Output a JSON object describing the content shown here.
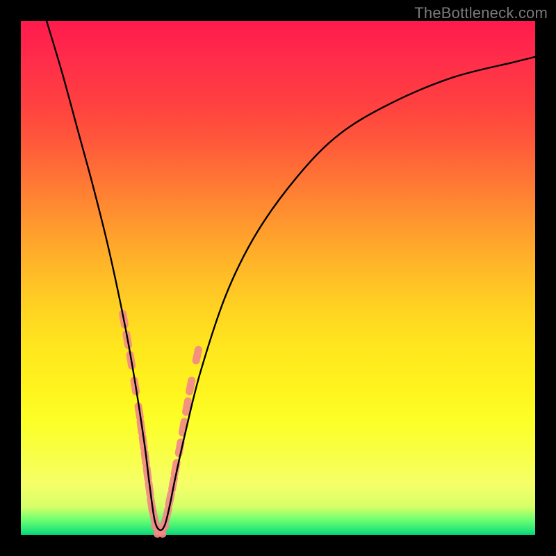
{
  "watermark": "TheBottleneck.com",
  "chart_data": {
    "type": "line",
    "title": "",
    "xlabel": "",
    "ylabel": "",
    "xlim": [
      0,
      100
    ],
    "ylim": [
      0,
      100
    ],
    "curve": {
      "name": "bottleneck-curve",
      "description": "V-shaped bottleneck curve. Steep left branch descends from top-left to a minimum near x≈26, then right branch rises with decreasing slope toward top-right.",
      "x": [
        5,
        8,
        11,
        14,
        17,
        20,
        22,
        24,
        25,
        26,
        27,
        28,
        29,
        30,
        32,
        35,
        40,
        46,
        54,
        62,
        72,
        84,
        96,
        100
      ],
      "y": [
        100,
        90,
        79,
        68,
        56,
        42,
        31,
        18,
        10,
        3,
        1,
        2,
        6,
        11,
        20,
        32,
        47,
        59,
        70,
        78,
        84,
        89,
        92,
        93
      ]
    },
    "markers": {
      "name": "highlighted-points",
      "type": "scatter",
      "color": "#f28a88",
      "description": "Pink dashed/capsule markers clustered along the lower portion of both branches near the valley.",
      "points": [
        {
          "x": 20.0,
          "y": 42
        },
        {
          "x": 20.7,
          "y": 38
        },
        {
          "x": 21.4,
          "y": 34
        },
        {
          "x": 22.2,
          "y": 29
        },
        {
          "x": 23.0,
          "y": 24
        },
        {
          "x": 23.4,
          "y": 21
        },
        {
          "x": 23.8,
          "y": 18
        },
        {
          "x": 24.2,
          "y": 15
        },
        {
          "x": 24.6,
          "y": 12
        },
        {
          "x": 25.0,
          "y": 9
        },
        {
          "x": 25.4,
          "y": 6
        },
        {
          "x": 25.8,
          "y": 4
        },
        {
          "x": 26.3,
          "y": 2
        },
        {
          "x": 26.8,
          "y": 1
        },
        {
          "x": 27.3,
          "y": 1
        },
        {
          "x": 27.8,
          "y": 2
        },
        {
          "x": 28.4,
          "y": 4
        },
        {
          "x": 29.0,
          "y": 7
        },
        {
          "x": 29.6,
          "y": 10
        },
        {
          "x": 30.1,
          "y": 13
        },
        {
          "x": 30.9,
          "y": 17
        },
        {
          "x": 31.6,
          "y": 21
        },
        {
          "x": 32.3,
          "y": 25
        },
        {
          "x": 33.0,
          "y": 29
        },
        {
          "x": 34.3,
          "y": 35
        }
      ]
    },
    "gradient_stops": [
      {
        "pos": 0.0,
        "color": "#ff1a4d"
      },
      {
        "pos": 0.35,
        "color": "#ff8a30"
      },
      {
        "pos": 0.68,
        "color": "#ffe41e"
      },
      {
        "pos": 0.92,
        "color": "#f6ff68"
      },
      {
        "pos": 0.975,
        "color": "#40e878"
      },
      {
        "pos": 1.0,
        "color": "#00c97a"
      }
    ]
  }
}
